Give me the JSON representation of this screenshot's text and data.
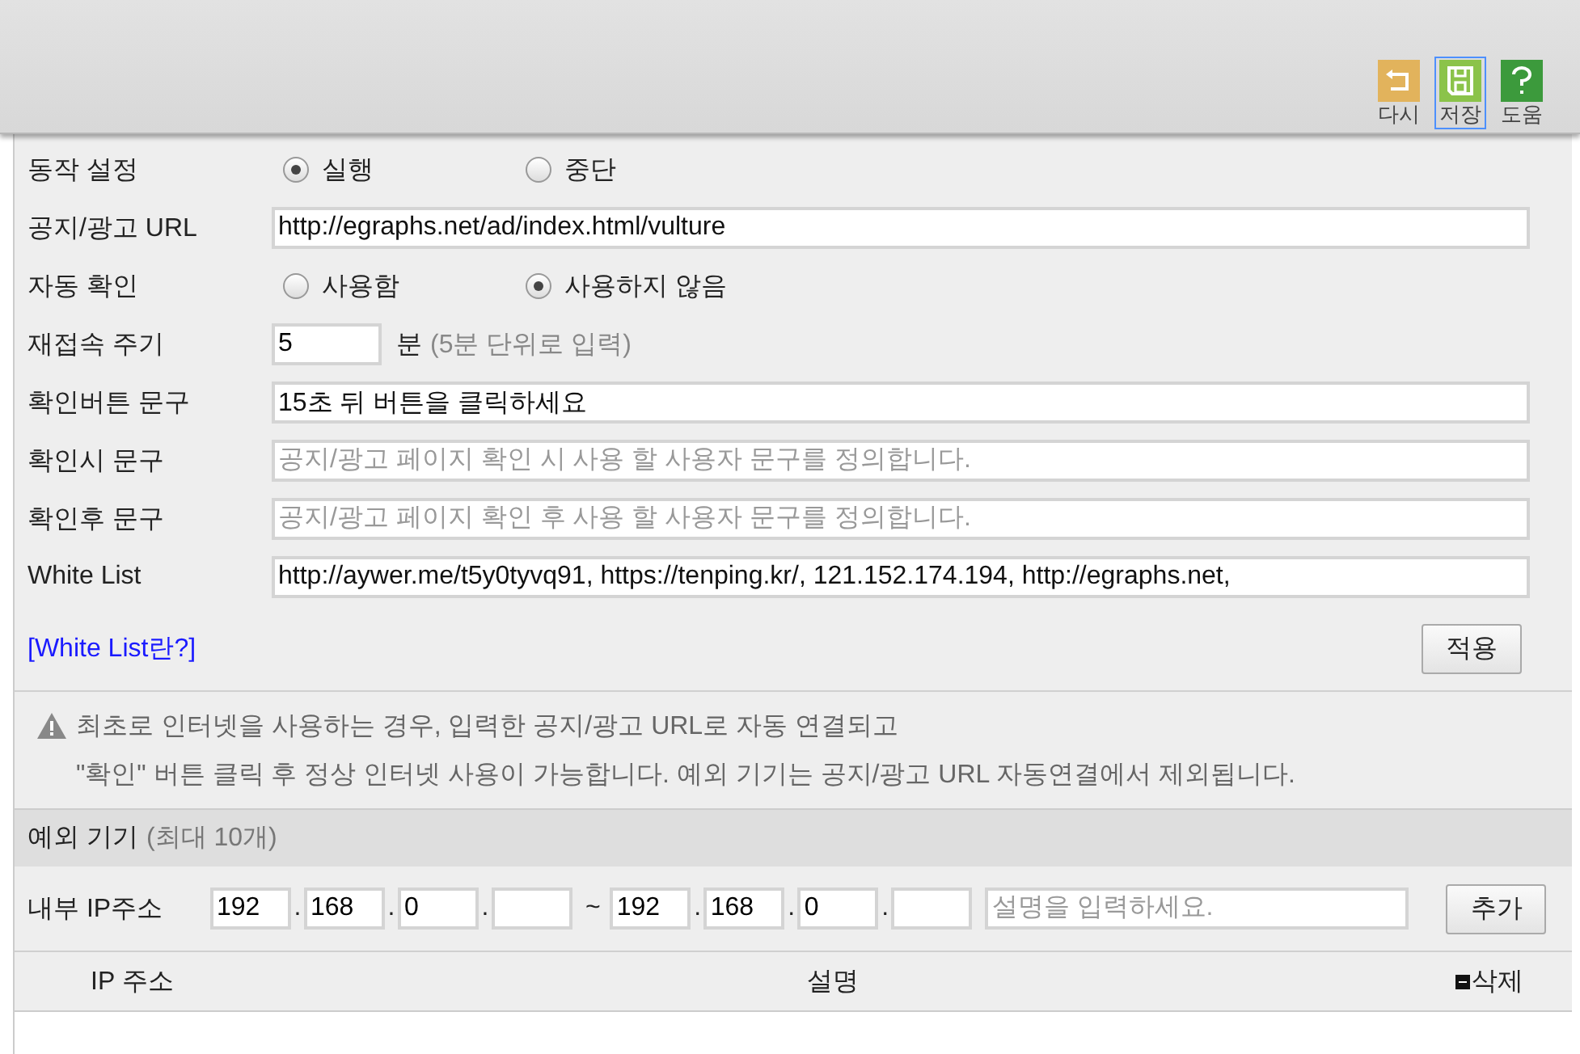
{
  "toolbar": {
    "buttons": [
      {
        "kind": "undo",
        "label": "다시",
        "selected": false
      },
      {
        "kind": "save",
        "label": "저장",
        "selected": true
      },
      {
        "kind": "help",
        "label": "도움",
        "selected": false
      }
    ]
  },
  "settings": {
    "rows": [
      {
        "kind": "radio",
        "label": "동작 설정",
        "options": [
          {
            "label": "실행",
            "selected": true
          },
          {
            "label": "중단",
            "selected": false
          }
        ]
      },
      {
        "kind": "text",
        "label": "공지/광고 URL",
        "value": "http://egraphs.net/ad/index.html/vulture"
      },
      {
        "kind": "radio",
        "label": "자동 확인",
        "options": [
          {
            "label": "사용함",
            "selected": false
          },
          {
            "label": "사용하지 않음",
            "selected": true
          }
        ]
      },
      {
        "kind": "number",
        "label": "재접속 주기",
        "value": "5",
        "unit": "분",
        "hint": "(5분 단위로 입력)"
      },
      {
        "kind": "text",
        "label": "확인버튼 문구",
        "value": "15초 뒤 버튼을 클릭하세요"
      },
      {
        "kind": "text",
        "label": "확인시 문구",
        "placeholder": "공지/광고 페이지 확인 시 사용 할 사용자 문구를 정의합니다."
      },
      {
        "kind": "text",
        "label": "확인후 문구",
        "placeholder": "공지/광고 페이지 확인 후 사용 할 사용자 문구를 정의합니다."
      },
      {
        "kind": "text",
        "label": "White List",
        "value": "http://aywer.me/t5y0tyvq91, https://tenping.kr/, 121.152.174.194, http://egraphs.net,"
      }
    ],
    "help_link": "[White List란?]",
    "apply_button": "적용"
  },
  "notice": {
    "lines": [
      "최초로 인터넷을 사용하는 경우, 입력한 공지/광고 URL로 자동 연결되고",
      "\"확인\" 버튼 클릭 후 정상 인터넷 사용이 가능합니다. 예외 기기는 공지/광고 URL 자동연결에서 제외됩니다."
    ]
  },
  "exceptions": {
    "title": "예외 기기",
    "note": "(최대 10개)",
    "ip_form": {
      "label": "내부 IP주소",
      "start": [
        {
          "kind": "filled",
          "value": "192",
          "dot": "."
        },
        {
          "kind": "filled",
          "value": "168",
          "dot": "."
        },
        {
          "kind": "filled",
          "value": "0",
          "dot": "."
        },
        {
          "kind": "empty"
        }
      ],
      "range_separator": "~",
      "end": [
        {
          "kind": "filled",
          "value": "192",
          "dot": "."
        },
        {
          "kind": "filled",
          "value": "168",
          "dot": "."
        },
        {
          "kind": "filled",
          "value": "0",
          "dot": "."
        },
        {
          "kind": "empty"
        }
      ],
      "description_placeholder": "설명을 입력하세요.",
      "add_button": "추가"
    },
    "table": {
      "columns": [
        {
          "kind": "text",
          "label": "IP 주소"
        },
        {
          "kind": "text",
          "label": "설명"
        },
        {
          "kind": "delete",
          "label": "삭제"
        }
      ]
    }
  }
}
